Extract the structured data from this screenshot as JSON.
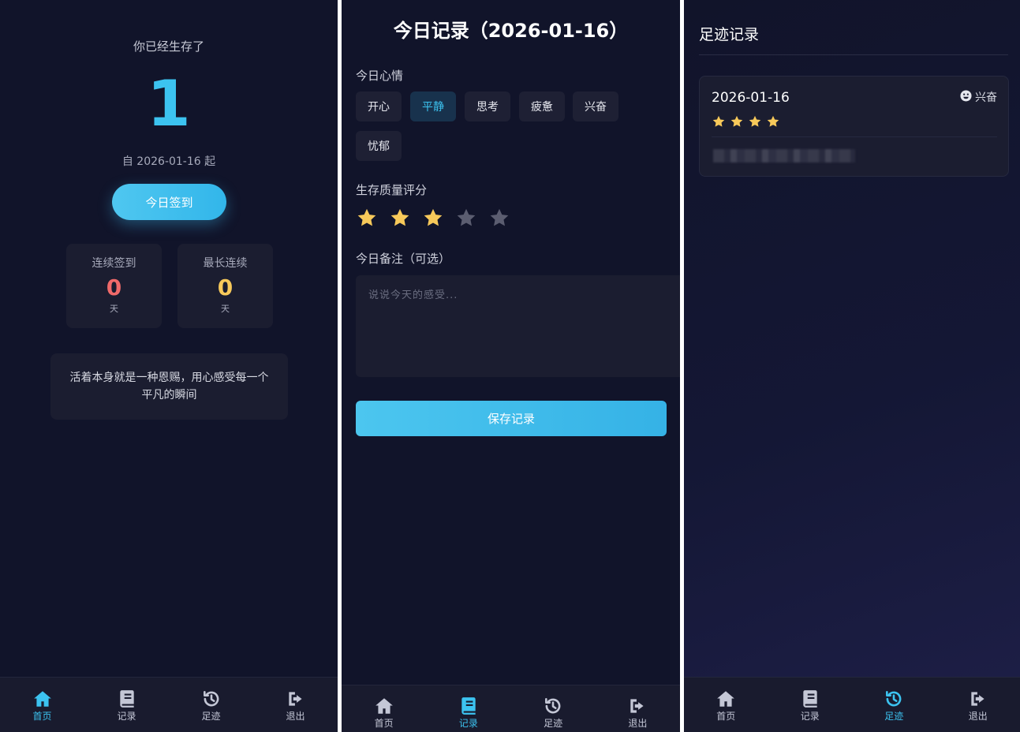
{
  "nav": {
    "home": "首页",
    "records": "记录",
    "footprints": "足迹",
    "logout": "退出"
  },
  "home": {
    "intro": "你已经生存了",
    "days_survived": "1",
    "since_text": "自 2026-01-16 起",
    "checkin_button": "今日签到",
    "streak_current": {
      "title": "连续签到",
      "value": "0",
      "unit": "天"
    },
    "streak_longest": {
      "title": "最长连续",
      "value": "0",
      "unit": "天"
    },
    "quote": "活着本身就是一种恩赐，用心感受每一个平凡的瞬间"
  },
  "today": {
    "title": "今日记录（2026-01-16）",
    "mood_label": "今日心情",
    "moods": [
      "开心",
      "平静",
      "思考",
      "疲惫",
      "兴奋",
      "忧郁"
    ],
    "selected_mood": "平静",
    "rating_label": "生存质量评分",
    "rating": 3,
    "rating_max": 5,
    "note_label": "今日备注（可选）",
    "note_placeholder": "说说今天的感受...",
    "save_button": "保存记录"
  },
  "footprints": {
    "title": "足迹记录",
    "records": [
      {
        "date": "2026-01-16",
        "mood": "兴奋",
        "rating": 4
      }
    ]
  },
  "colors": {
    "background": "#11142a",
    "accent": "#3cc3f0",
    "star_on": "#f7c95a",
    "star_off": "#5b5d70",
    "streak_current": "#f06a6a",
    "streak_longest": "#f7c95a"
  }
}
